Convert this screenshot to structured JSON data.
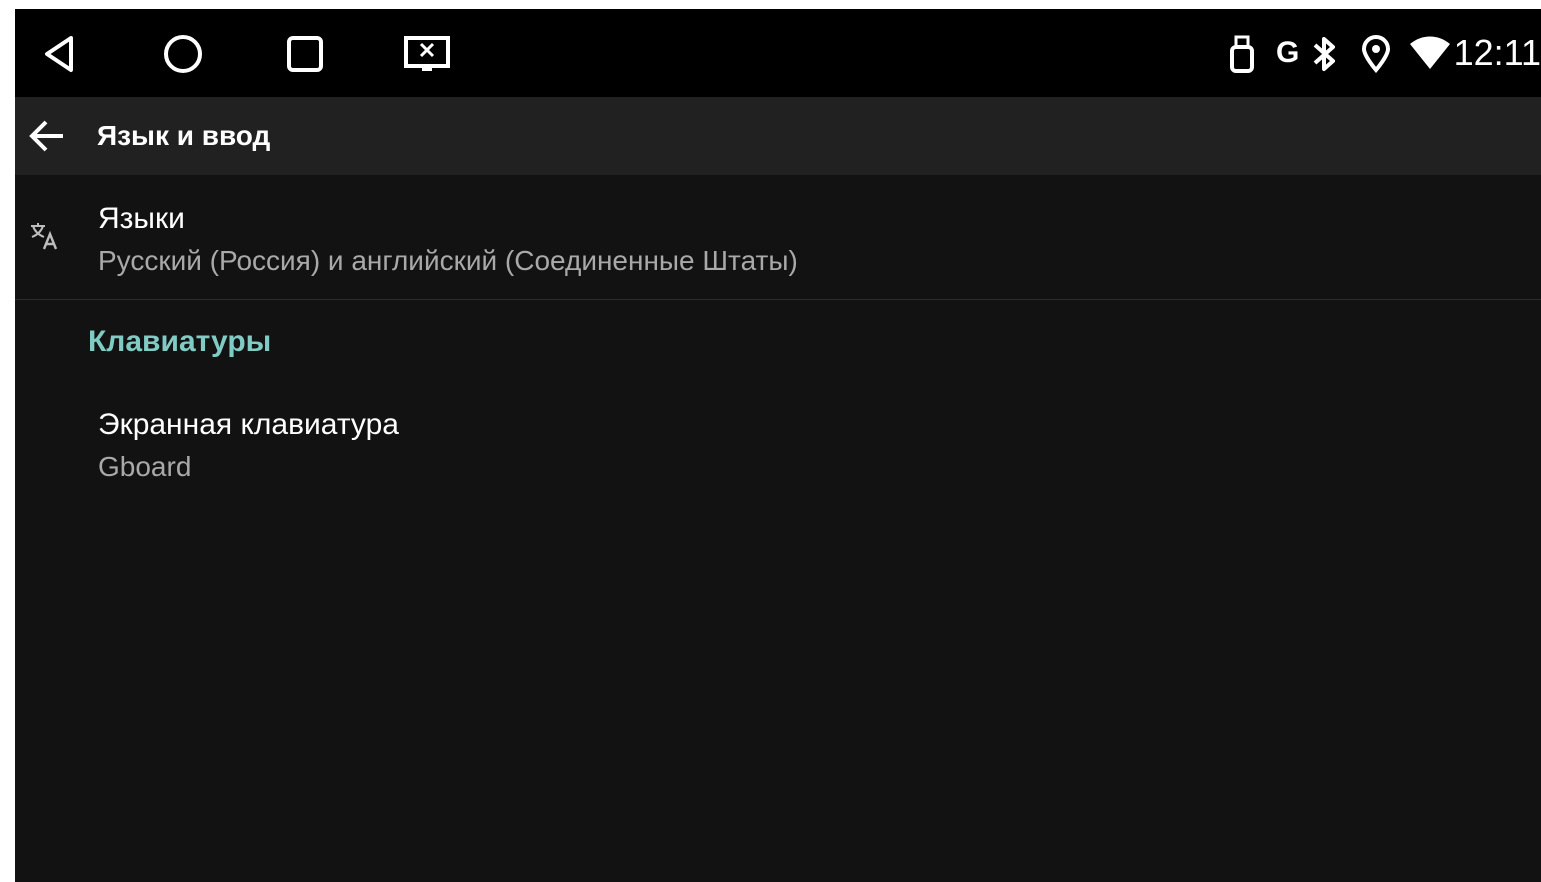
{
  "status_bar": {
    "nav": [
      "back-icon",
      "home-icon",
      "recents-icon",
      "screen-close-icon"
    ],
    "icons": [
      "usb-icon",
      "bluetooth-icon",
      "location-icon",
      "wifi-icon"
    ],
    "network_label": "G",
    "time": "12:11"
  },
  "toolbar": {
    "back_icon": "arrow-back-icon",
    "title": "Язык и ввод"
  },
  "settings": {
    "languages": {
      "icon": "translate-icon",
      "title": "Языки",
      "summary": "Русский (Россия) и английский (Соединенные Штаты)"
    },
    "keyboards_header": "Клавиатуры",
    "onscreen_keyboard": {
      "title": "Экранная клавиатура",
      "summary": "Gboard"
    }
  },
  "colors": {
    "background": "#121212",
    "toolbar": "#212121",
    "accent": "#80cbc4",
    "summary_text": "#a9a9a9"
  }
}
